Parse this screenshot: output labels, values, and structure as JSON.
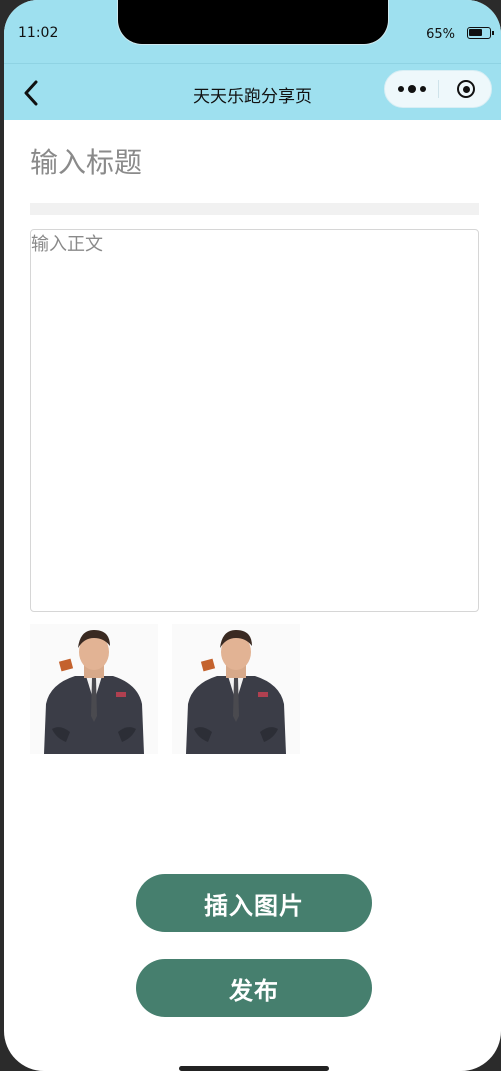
{
  "status_bar": {
    "time": "11:02",
    "battery": "65%",
    "battery_level": 0.65
  },
  "nav": {
    "title": "天天乐跑分享页",
    "back_icon": "chevron-left-icon",
    "more_icon": "more-dots-icon",
    "close_icon": "target-close-icon"
  },
  "form": {
    "title_placeholder": "输入标题",
    "body_placeholder": "输入正文"
  },
  "images": [
    {
      "alt": "man-in-suit"
    },
    {
      "alt": "man-in-suit"
    }
  ],
  "actions": {
    "insert_image": "插入图片",
    "publish": "发布"
  },
  "colors": {
    "nav_bg": "#9ee0ef",
    "button_bg": "#467f6e",
    "button_text": "#ffffff"
  }
}
